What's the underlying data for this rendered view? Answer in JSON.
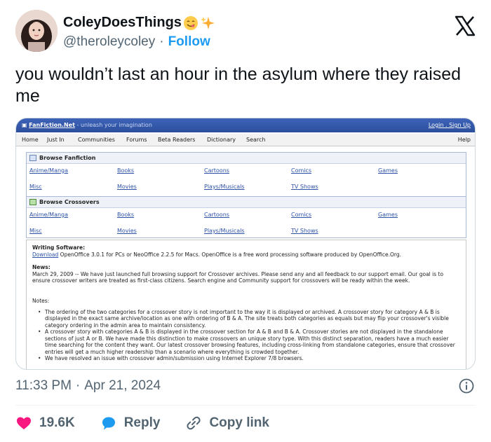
{
  "tweet": {
    "display_name": "ColeyDoesThings",
    "handle": "@theroleycoley",
    "follow_label": "Follow",
    "text": "you wouldn’t last an hour in the asylum where they raised me",
    "time": "11:33 PM",
    "date": "Apr 21, 2024",
    "likes": "19.6K",
    "reply_label": "Reply",
    "copy_link_label": "Copy link",
    "colors": {
      "like": "#f91880",
      "reply": "#1d9bf0",
      "follow": "#1d9bf0"
    }
  },
  "screenshot": {
    "site_name": "FanFiction.Net",
    "tagline": "- unleash your imagination",
    "login": "Login . Sign Up",
    "nav": [
      "Home",
      "Just In",
      "Communities",
      "Forums",
      "Beta Readers",
      "Dictionary",
      "Search"
    ],
    "help": "Help",
    "browse_fanfiction": {
      "title": "Browse Fanfiction",
      "categories": [
        "Anime/Manga",
        "Books",
        "Cartoons",
        "Comics",
        "Games",
        "Misc",
        "Movies",
        "Plays/Musicals",
        "TV Shows"
      ]
    },
    "browse_crossovers": {
      "title": "Browse Crossovers",
      "categories": [
        "Anime/Manga",
        "Books",
        "Cartoons",
        "Comics",
        "Games",
        "Misc",
        "Movies",
        "Plays/Musicals",
        "TV Shows"
      ]
    },
    "writing_software": {
      "heading": "Writing Software:",
      "download": "Download",
      "text": "OpenOffice 3.0.1 for PCs or NeoOffice 2.2.5 for Macs. OpenOffice is a free word processing software produced by OpenOffice.Org."
    },
    "news": {
      "heading": "News:",
      "text": "March 29, 2009 -- We have just launched full browsing support for Crossover archives. Please send any and all feedback to our support email. Our goal is to ensure crossover writers are treated as first-class citizens. Search engine and Community support for crossovers will be ready within the week."
    },
    "notes": {
      "heading": "Notes:",
      "items": [
        "The ordering of the two categories for a crossover story is not important to the way it is displayed or archived. A crossover story for category A & B is displayed in the exact same archive/location as one with ordering of B & A. The site treats both categories as equals but may flip your crossover's visible category ordering in the admin area to maintain consistency.",
        "A crossover story with categories A & B is displayed in the crossover section for A & B and B & A. Crossover stories are not displayed in the standalone sections of just A or B. We have made this distinction to make crossovers an unique story type. With this distinct separation, readers have a much easier time searching for the content they want. Our latest crossover browsing features, including cross-linking from standalone categories, ensure that crossover entries will get a much higher readership than a scenario where everything is crowded together.",
        "We have resolved an issue with crossover admin/submission using Internet Explorer 7/8 browsers."
      ]
    }
  }
}
